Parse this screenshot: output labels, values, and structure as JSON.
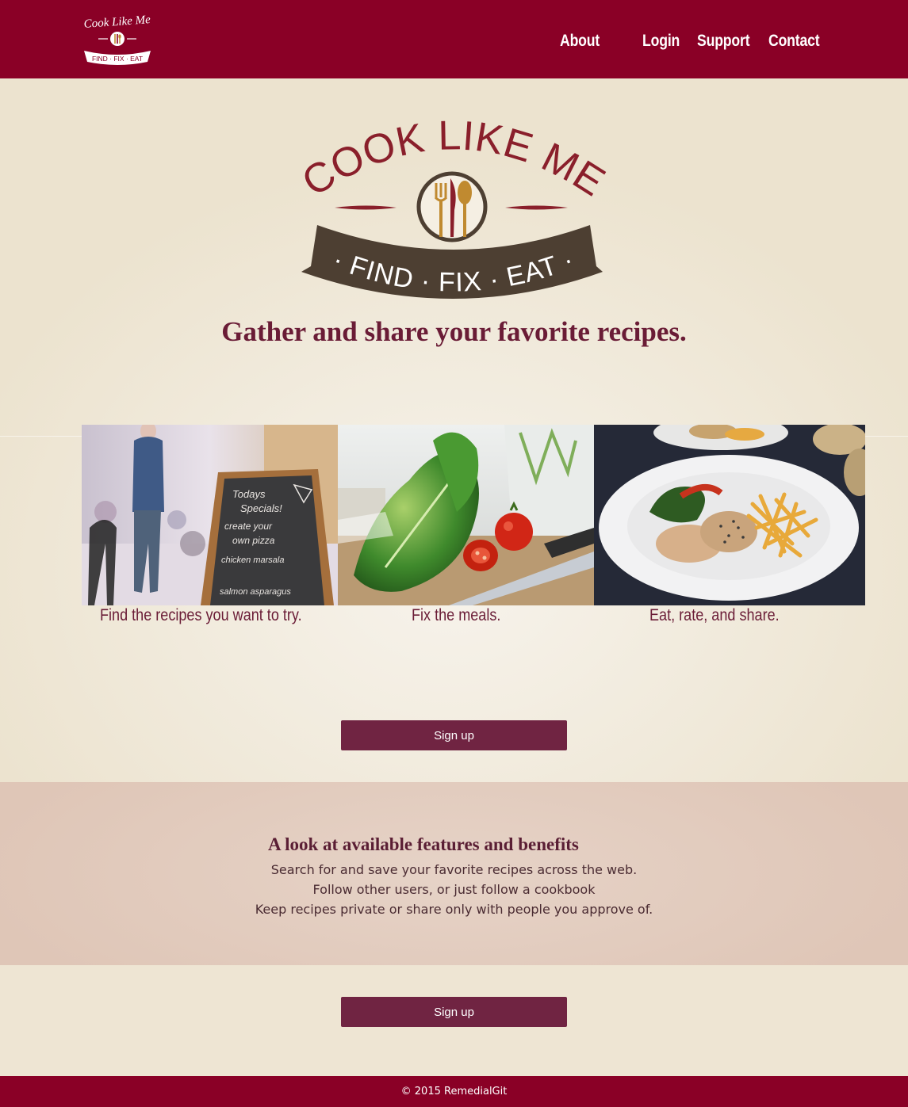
{
  "brand": {
    "small_logo_text": "Cook Like Me",
    "small_logo_ribbon": "FIND · FIX · EAT",
    "big_logo_title": "COOK LIKE ME",
    "big_logo_ribbon": "· FIND · FIX · EAT ·"
  },
  "nav": {
    "about": "About",
    "login": "Login",
    "support": "Support",
    "contact": "Contact"
  },
  "hero": {
    "tagline": "Gather and share your favorite recipes.",
    "steps": [
      {
        "caption": "Find the recipes you want to try.",
        "image": "chalkboard-specials-photo"
      },
      {
        "caption": "Fix the meals.",
        "image": "lettuce-tomato-photo"
      },
      {
        "caption": "Eat, rate, and share.",
        "image": "plated-chicken-fries-photo"
      }
    ],
    "chalkboard_text": [
      "Todays",
      "Specials!",
      "create your",
      "own pizza",
      "chicken marsala",
      "salmon asparagus"
    ]
  },
  "buttons": {
    "signup_top": "Sign up",
    "signup_bottom": "Sign up"
  },
  "features": {
    "title": "A look at available features and benefits",
    "lines": [
      "Search for and save your favorite recipes across the web.",
      "Follow other users, or just follow a cookbook",
      "Keep recipes private or share only with people you approve of."
    ]
  },
  "footer": {
    "copyright": "© 2015 RemedialGit"
  },
  "colors": {
    "brand_maroon": "#8a0026",
    "button_plum": "#702442",
    "text_plum": "#6a1c36",
    "cream": "#eee5d3",
    "features_blush": "#dfc6b7",
    "logo_brown": "#4d3f32",
    "logo_gold": "#c08a30"
  }
}
